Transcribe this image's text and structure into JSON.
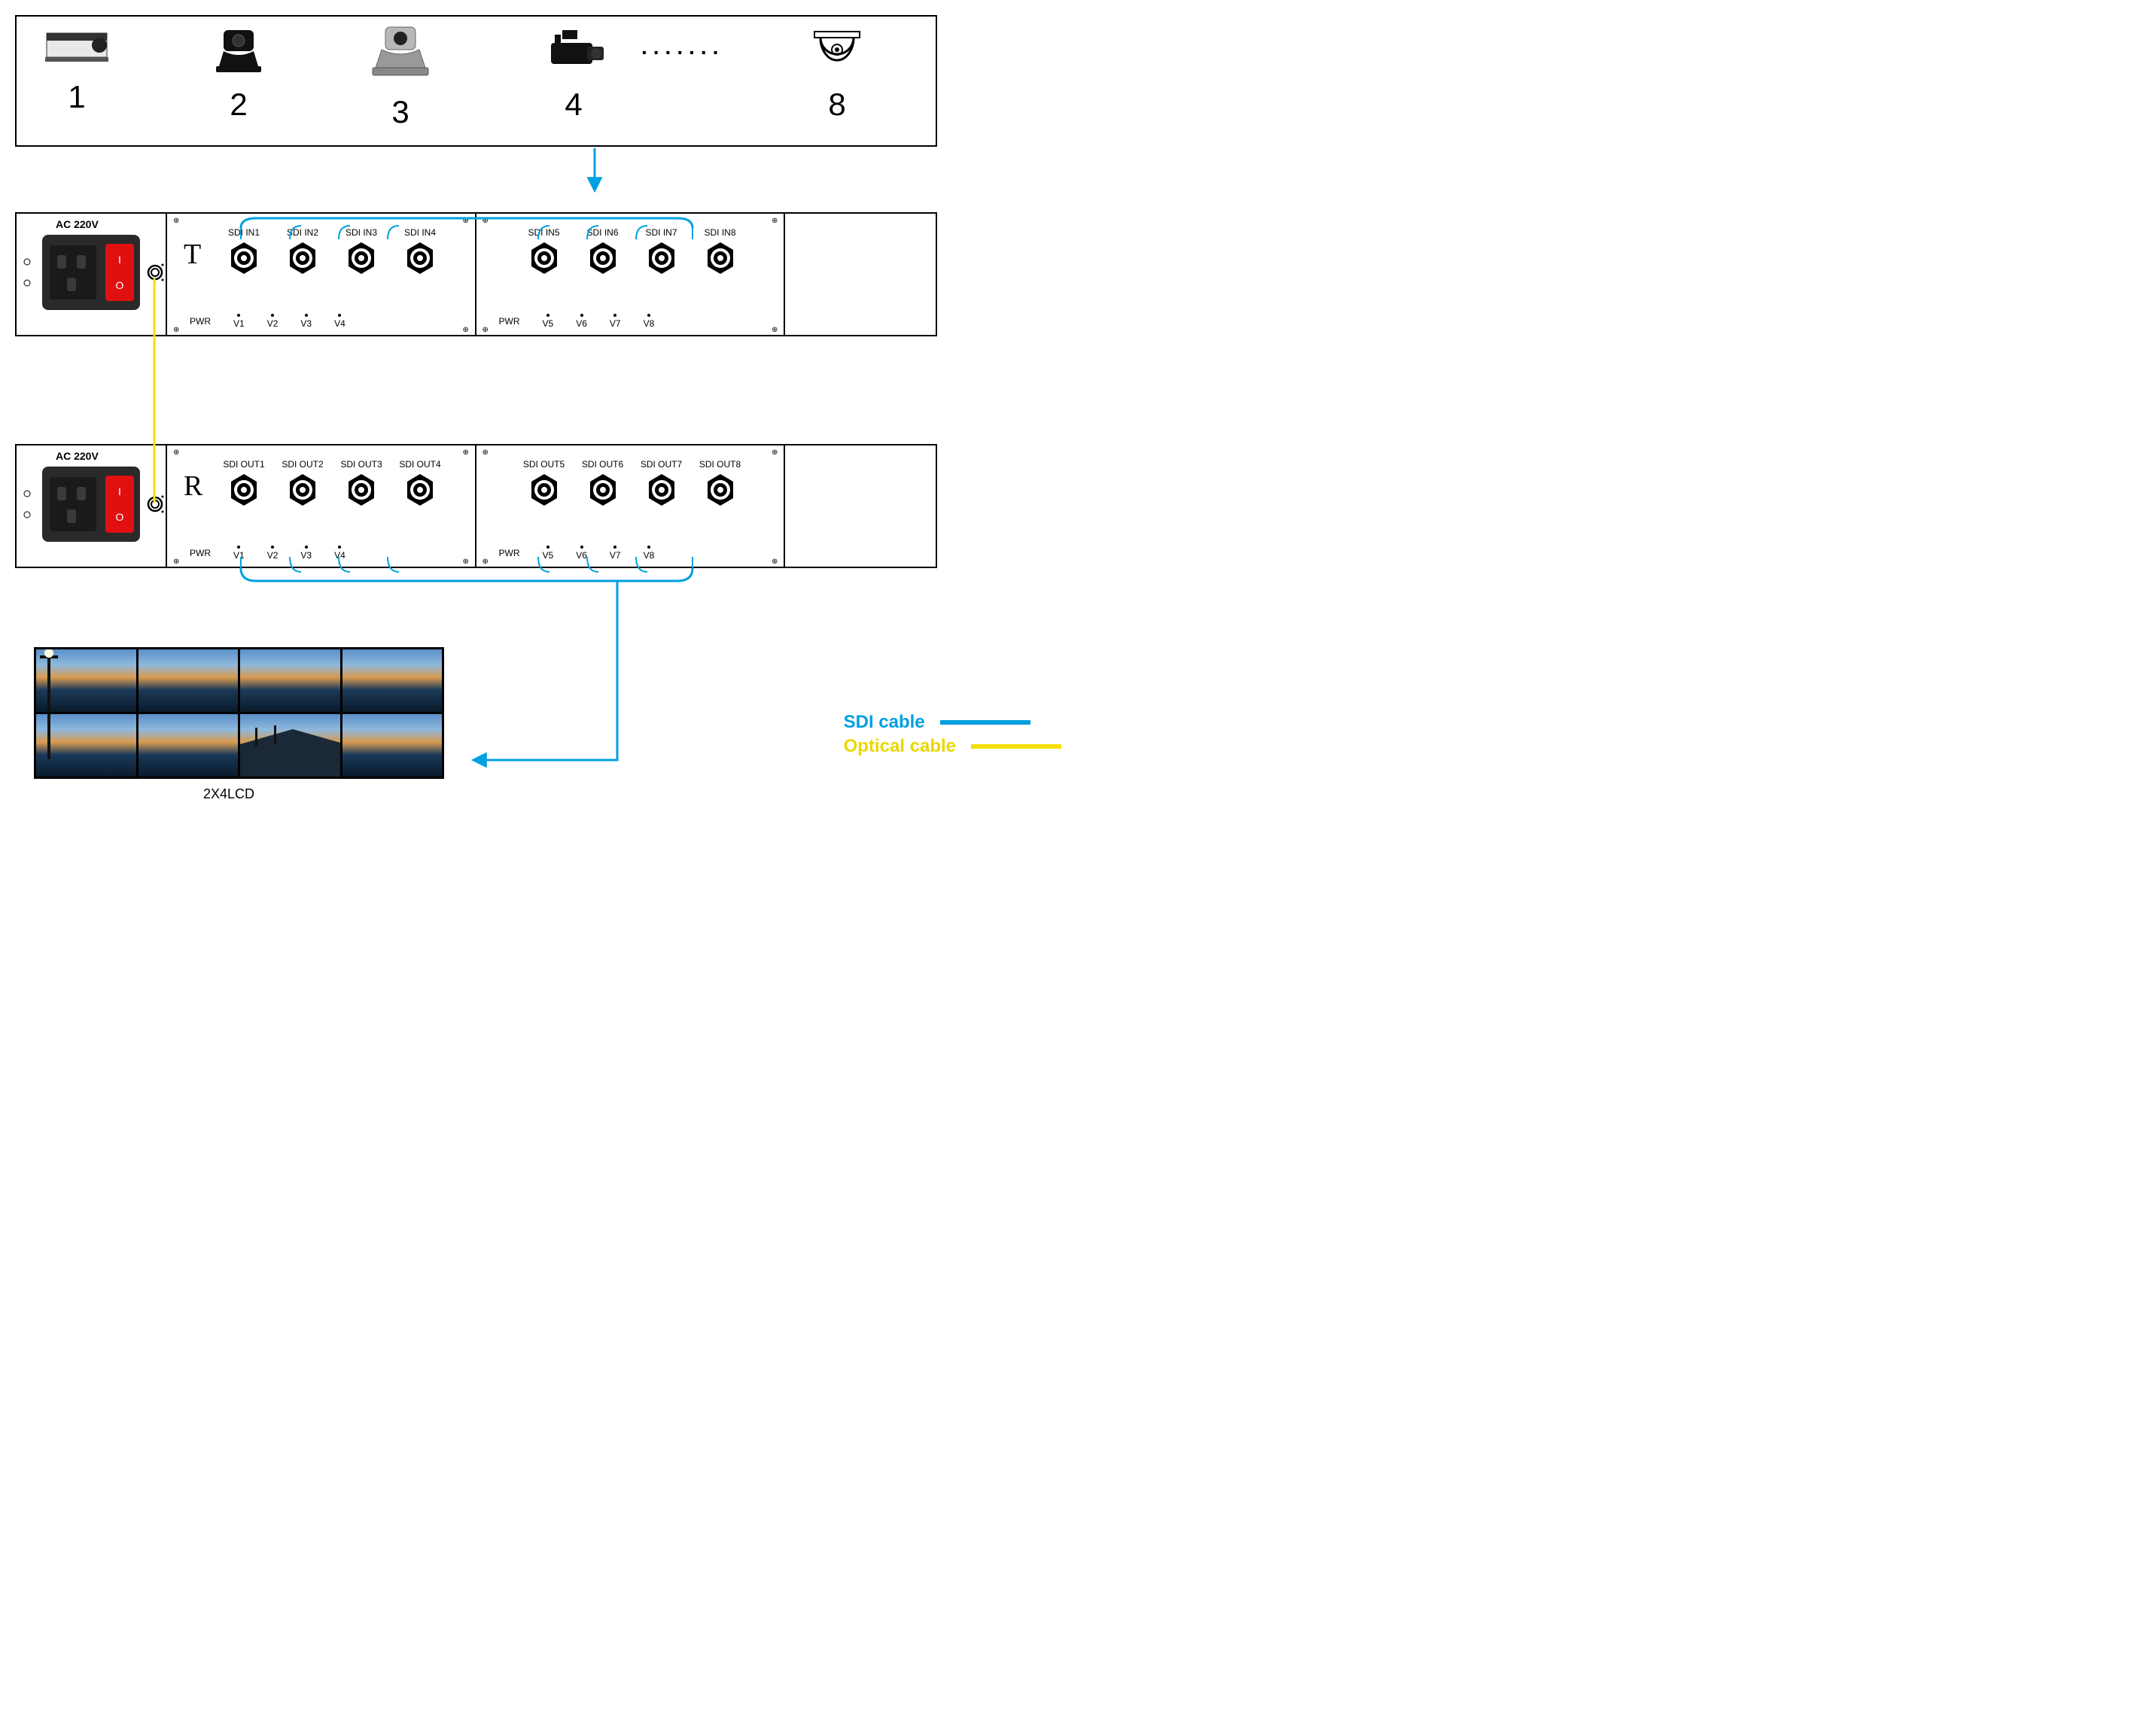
{
  "cameras": {
    "items": [
      {
        "number": "1",
        "type": "box-camera"
      },
      {
        "number": "2",
        "type": "ptz-camera-black"
      },
      {
        "number": "3",
        "type": "ptz-camera-silver"
      },
      {
        "number": "4",
        "type": "pro-camcorder"
      },
      {
        "number": "8",
        "type": "dome-camera"
      }
    ],
    "ellipsis": "......."
  },
  "transmitter": {
    "power_label": "AC 220V",
    "unit_letter": "T",
    "left_module": {
      "ports": [
        "SDI IN1",
        "SDI IN2",
        "SDI IN3",
        "SDI IN4"
      ],
      "pwr": "PWR",
      "leds": [
        "V1",
        "V2",
        "V3",
        "V4"
      ]
    },
    "right_module": {
      "ports": [
        "SDI IN5",
        "SDI IN6",
        "SDI IN7",
        "SDI IN8"
      ],
      "pwr": "PWR",
      "leds": [
        "V5",
        "V6",
        "V7",
        "V8"
      ]
    }
  },
  "receiver": {
    "power_label": "AC 220V",
    "unit_letter": "R",
    "left_module": {
      "ports": [
        "SDI OUT1",
        "SDI OUT2",
        "SDI OUT3",
        "SDI OUT4"
      ],
      "pwr": "PWR",
      "leds": [
        "V1",
        "V2",
        "V3",
        "V4"
      ]
    },
    "right_module": {
      "ports": [
        "SDI OUT5",
        "SDI OUT6",
        "SDI OUT7",
        "SDI OUT8"
      ],
      "pwr": "PWR",
      "leds": [
        "V5",
        "V6",
        "V7",
        "V8"
      ]
    }
  },
  "video_wall": {
    "label": "2X4LCD",
    "rows": 2,
    "cols": 4
  },
  "legend": {
    "sdi": {
      "label": "SDI cable",
      "color": "#00a0e0"
    },
    "optical": {
      "label": "Optical cable",
      "color": "#f5e000"
    }
  },
  "colors": {
    "sdi_cable": "#00a0e0",
    "optical_cable": "#f5e000",
    "switch_red": "#e01010"
  }
}
